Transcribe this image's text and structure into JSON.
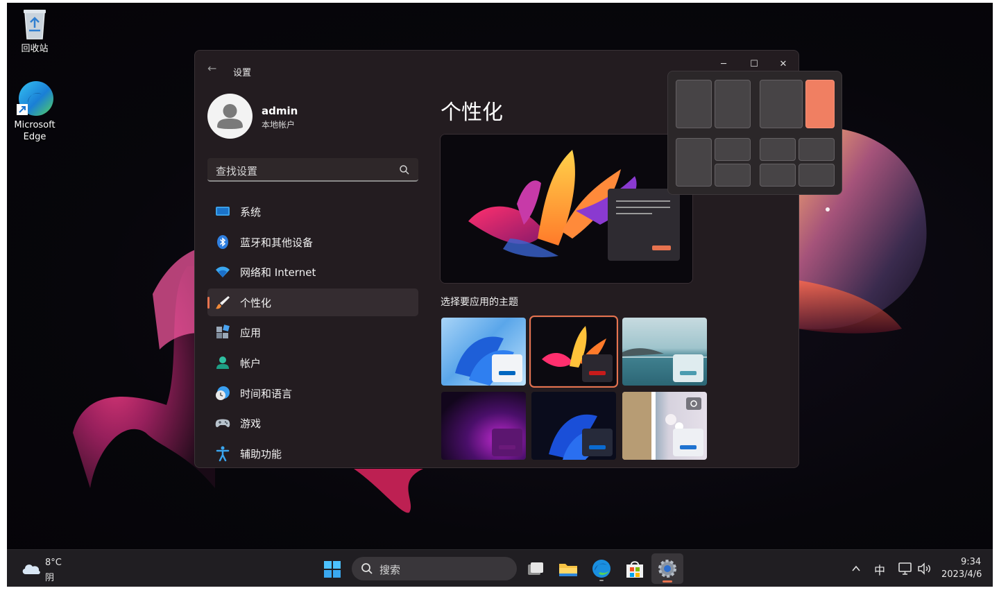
{
  "desktop": {
    "icons": [
      {
        "label": "回收站"
      },
      {
        "label": "Microsoft\nEdge",
        "label_line1": "Microsoft",
        "label_line2": "Edge"
      }
    ]
  },
  "settings": {
    "app_title": "设置",
    "window_controls": {
      "minimize": "─",
      "maximize": "☐",
      "close": "✕"
    },
    "profile": {
      "name": "admin",
      "account_type": "本地帐户"
    },
    "search": {
      "placeholder": "查找设置"
    },
    "nav": [
      {
        "label": "系统",
        "icon": "monitor-icon"
      },
      {
        "label": "蓝牙和其他设备",
        "icon": "bluetooth-icon"
      },
      {
        "label": "网络和 Internet",
        "icon": "wifi-icon"
      },
      {
        "label": "个性化",
        "icon": "brush-icon",
        "active": true
      },
      {
        "label": "应用",
        "icon": "apps-icon"
      },
      {
        "label": "帐户",
        "icon": "person-icon"
      },
      {
        "label": "时间和语言",
        "icon": "clock-globe-icon"
      },
      {
        "label": "游戏",
        "icon": "gamepad-icon"
      },
      {
        "label": "辅助功能",
        "icon": "accessibility-icon"
      }
    ],
    "page_title": "个性化",
    "themes_label": "选择要应用的主题",
    "themes": [
      {
        "name": "windows-light",
        "accent": "#0067c0",
        "selected": false
      },
      {
        "name": "glow-dark",
        "accent": "#c81b1b",
        "selected": true
      },
      {
        "name": "lake",
        "accent": "#4a9cb0",
        "selected": false
      },
      {
        "name": "purple-glow",
        "accent": "#6b1a7a",
        "selected": false
      },
      {
        "name": "windows-dark",
        "accent": "#0a6ad0",
        "selected": false
      },
      {
        "name": "spotlight",
        "accent": "#1e72d0",
        "selected": false
      }
    ],
    "accent_color": "#e7734f"
  },
  "taskbar": {
    "weather": {
      "temp": "8°C",
      "condition": "阴"
    },
    "search_label": "搜索",
    "tray": {
      "ime": "中",
      "time": "9:34",
      "date": "2023/4/6"
    }
  }
}
